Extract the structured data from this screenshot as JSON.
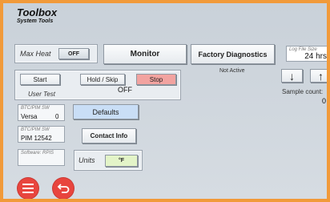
{
  "app": {
    "title": "Toolbox",
    "subtitle": "System Tools"
  },
  "max_heat": {
    "label": "Max Heat",
    "toggle": "OFF"
  },
  "buttons": {
    "monitor": "Monitor",
    "factory_diagnostics": "Factory Diagnostics",
    "start": "Start",
    "hold_skip": "Hold / Skip",
    "stop": "Stop",
    "defaults": "Defaults",
    "contact_info": "Contact Info"
  },
  "status": {
    "factory": "Not Active",
    "user_test_label": "User Test",
    "user_test_state": "OFF"
  },
  "log_file": {
    "label": "Log File Size",
    "value": "24 hrs"
  },
  "sample_count": {
    "label": "Sample count:",
    "value": "0"
  },
  "fields": {
    "btc_pim_sw_1": {
      "label": "BTC/PIM SW",
      "name": "Versa",
      "value": "0"
    },
    "btc_pim_sw_2": {
      "label": "BTC/PIM SW",
      "value": "PIM 12542"
    },
    "software_rpis": {
      "label": "Software: RPIS",
      "value": ""
    }
  },
  "units": {
    "label": "Units",
    "value": "°F"
  },
  "colors": {
    "border": "#f19a3a",
    "accent_red": "#e8453e",
    "stop_red": "#f2a3a0",
    "defaults_blue": "#c9def6",
    "toggle_green": "#e3f4c8"
  }
}
